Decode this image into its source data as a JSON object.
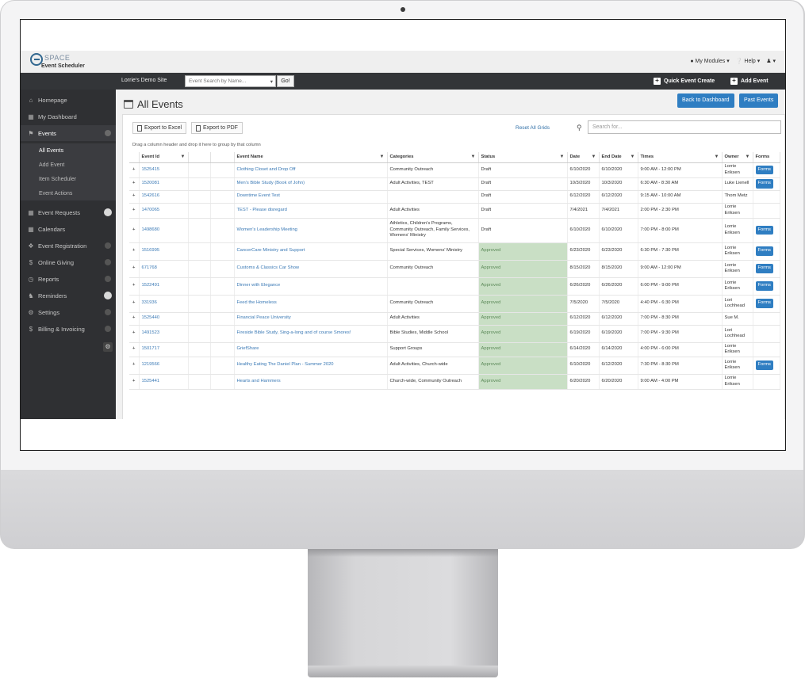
{
  "app": {
    "logo_text": "SPACE",
    "logo_sub": "Event Scheduler",
    "top_links": [
      "My Modules",
      "Help"
    ],
    "site_name": "Lorrie's Demo Site",
    "search_placeholder": "Event Search by Name...",
    "go_label": "Go!",
    "quick_create": "Quick Event Create",
    "add_event": "Add Event"
  },
  "sidebar": {
    "items": [
      {
        "label": "Homepage",
        "icon": "home-icon"
      },
      {
        "label": "My Dashboard",
        "icon": "dashboard-icon"
      },
      {
        "label": "Events",
        "icon": "megaphone-icon"
      },
      {
        "label": "Event Requests",
        "icon": "calendar-icon"
      },
      {
        "label": "Calendars",
        "icon": "calendar-icon"
      },
      {
        "label": "Event Registration",
        "icon": "tag-icon"
      },
      {
        "label": "Online Giving",
        "icon": "dollar-icon"
      },
      {
        "label": "Reports",
        "icon": "clock-icon"
      },
      {
        "label": "Reminders",
        "icon": "bell-icon"
      },
      {
        "label": "Settings",
        "icon": "gear-icon"
      },
      {
        "label": "Billing & Invoicing",
        "icon": "dollar-icon"
      }
    ],
    "sub_items": [
      "All Events",
      "Add Event",
      "Item Scheduler",
      "Event Actions"
    ]
  },
  "main": {
    "title": "All Events",
    "back_dashboard": "Back to Dashboard",
    "past_events": "Past Events",
    "export_excel": "Export to Excel",
    "export_pdf": "Export to PDF",
    "reset_grids": "Reset All Grids",
    "search_placeholder": "Search for...",
    "group_note": "Drag a column header and drop it here to group by that column"
  },
  "table": {
    "headers": [
      "Event Id",
      "Event Name",
      "Categories",
      "Status",
      "Date",
      "End Date",
      "Times",
      "Owner",
      "Forms"
    ],
    "forms_label": "Forms",
    "rows": [
      {
        "id": "1525415",
        "name": "Clothing Closet and Drop Off",
        "cat": "Community Outreach",
        "status": "Draft",
        "date": "6/10/2020",
        "end": "6/10/2020",
        "times": "9:00 AM - 12:00 PM",
        "owner": "Lorrie Eriksen",
        "forms": true
      },
      {
        "id": "1520081",
        "name": "Men's Bible Study (Book of John)",
        "cat": "Adult Activities, TEST",
        "status": "Draft",
        "date": "10/3/2020",
        "end": "10/3/2020",
        "times": "6:30 AM - 8:30 AM",
        "owner": "Luke Lienell",
        "forms": true
      },
      {
        "id": "1542616",
        "name": "Downtime Event Test",
        "cat": "",
        "status": "Draft",
        "date": "6/12/2020",
        "end": "6/12/2020",
        "times": "9:15 AM - 10:00 AM",
        "owner": "Thom Metz",
        "forms": false
      },
      {
        "id": "1470065",
        "name": "TEST - Please disregard",
        "cat": "Adult Activities",
        "status": "Draft",
        "date": "7/4/2021",
        "end": "7/4/2021",
        "times": "2:00 PM - 2:30 PM",
        "owner": "Lorrie Eriksen",
        "forms": false
      },
      {
        "id": "1498680",
        "name": "Women's Leadership Meeting",
        "cat": "Athletics, Children's Programs, Community Outreach, Family Services, Womens' Ministry",
        "status": "Draft",
        "date": "6/10/2020",
        "end": "6/10/2020",
        "times": "7:00 PM - 8:00 PM",
        "owner": "Lorrie Eriksen",
        "forms": true
      },
      {
        "id": "1516995",
        "name": "CancerCare Ministry and Support",
        "cat": "Special Services, Womens' Ministry",
        "status": "Approved",
        "date": "6/23/2020",
        "end": "6/23/2020",
        "times": "6:30 PM - 7:30 PM",
        "owner": "Lorrie Eriksen",
        "forms": true
      },
      {
        "id": "671768",
        "name": "Customs & Classics Car Show",
        "cat": "Community Outreach",
        "status": "Approved",
        "date": "8/15/2020",
        "end": "8/15/2020",
        "times": "9:00 AM - 12:00 PM",
        "owner": "Lorrie Eriksen",
        "forms": true
      },
      {
        "id": "1522491",
        "name": "Dinner with Elegance",
        "cat": "",
        "status": "Approved",
        "date": "6/26/2020",
        "end": "6/26/2020",
        "times": "6:00 PM - 9:00 PM",
        "owner": "Lorrie Eriksen",
        "forms": true
      },
      {
        "id": "331936",
        "name": "Feed the Homeless",
        "cat": "Community Outreach",
        "status": "Approved",
        "date": "7/5/2020",
        "end": "7/5/2020",
        "times": "4:40 PM - 6:30 PM",
        "owner": "Lori Lochhead",
        "forms": true
      },
      {
        "id": "1525440",
        "name": "Financial Peace University",
        "cat": "Adult Activities",
        "status": "Approved",
        "date": "6/12/2020",
        "end": "6/12/2020",
        "times": "7:00 PM - 8:30 PM",
        "owner": "Sue M.",
        "forms": false
      },
      {
        "id": "1491523",
        "name": "Fireside Bible Study, Sing-a-long and of course Smores!",
        "cat": "Bible Studies, Middle School",
        "status": "Approved",
        "date": "6/19/2020",
        "end": "6/19/2020",
        "times": "7:00 PM - 9:30 PM",
        "owner": "Lori Lochhead",
        "forms": false
      },
      {
        "id": "1501717",
        "name": "GriefShare",
        "cat": "Support Groups",
        "status": "Approved",
        "date": "6/14/2020",
        "end": "6/14/2020",
        "times": "4:00 PM - 6:00 PM",
        "owner": "Lorrie Eriksen",
        "forms": false
      },
      {
        "id": "1219566",
        "name": "Healthy Eating The Daniel Plan - Summer 2020",
        "cat": "Adult Activities, Church-wide",
        "status": "Approved",
        "date": "6/10/2020",
        "end": "6/12/2020",
        "times": "7:30 PM - 8:30 PM",
        "owner": "Lorrie Eriksen",
        "forms": true
      },
      {
        "id": "1525441",
        "name": "Hearts and Hammers",
        "cat": "Church-wide, Community Outreach",
        "status": "Approved",
        "date": "6/20/2020",
        "end": "6/20/2020",
        "times": "9:00 AM - 4:00 PM",
        "owner": "Lorrie Eriksen",
        "forms": false
      }
    ]
  }
}
